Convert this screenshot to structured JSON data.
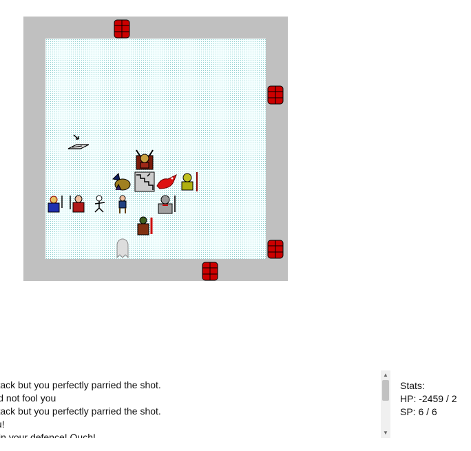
{
  "game": {
    "log_lines": [
      "recent attack but you perfectly parried the shot.",
      "s work did not fool you",
      "recent attack but you perfectly parried the shot.",
      " hit on you!",
      "ack spot in your defence! Ouch!"
    ],
    "stats": {
      "title": "Stats:",
      "hp": "HP: -2459 / 2",
      "sp": "SP: 6 / 6"
    }
  },
  "colors": {
    "wall": "#c0c0c0",
    "floor": "#f6ffff",
    "door": "#cc0000"
  },
  "icons": {
    "door": "red-door-icon",
    "trap": "trap-plate-icon",
    "stairs": "stairs-icon",
    "demon": "horned-demon-icon",
    "dragon": "red-dragon-icon",
    "ghost": "ghost-icon"
  }
}
